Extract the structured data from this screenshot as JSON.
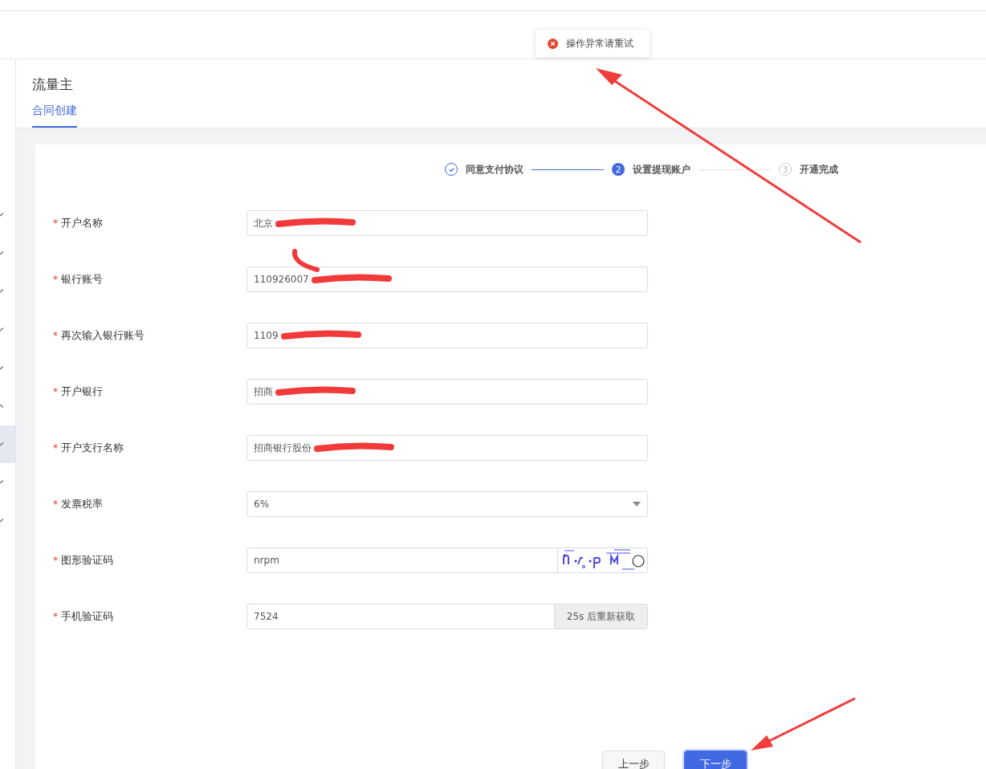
{
  "toast": {
    "kind": "error",
    "message": "操作异常请重试"
  },
  "sidebar": {
    "items": [
      {
        "expanded": false,
        "selected": false
      },
      {
        "expanded": false,
        "selected": false
      },
      {
        "expanded": false,
        "selected": false
      },
      {
        "expanded": false,
        "selected": false
      },
      {
        "expanded": false,
        "selected": false
      },
      {
        "expanded": true,
        "selected": false
      },
      {
        "expanded": false,
        "selected": true
      },
      {
        "expanded": false,
        "selected": false
      },
      {
        "expanded": false,
        "selected": false
      }
    ]
  },
  "page_header": {
    "title": "流量主",
    "tabs": [
      {
        "label": "合同创建",
        "selected": true
      }
    ]
  },
  "steps": [
    {
      "kind": "done",
      "label": "同意支付协议"
    },
    {
      "kind": "active",
      "number": "2",
      "label": "设置提现账户"
    },
    {
      "kind": "wait",
      "number": "3",
      "label": "开通完成"
    }
  ],
  "form": [
    {
      "kind": "text",
      "label": "开户名称",
      "required_mark": "*",
      "value": "北京",
      "redacted": true
    },
    {
      "kind": "text",
      "label": "银行账号",
      "required_mark": "*",
      "value": "110926007",
      "redacted": true
    },
    {
      "kind": "text",
      "label": "再次输入银行账号",
      "required_mark": "*",
      "value": "1109",
      "redacted": true
    },
    {
      "kind": "text",
      "label": "开户银行",
      "required_mark": "*",
      "value": "招商",
      "redacted": true
    },
    {
      "kind": "text",
      "label": "开户支行名称",
      "required_mark": "*",
      "value": "招商银行股份",
      "redacted": true
    },
    {
      "kind": "select",
      "label": "发票税率",
      "required_mark": "*",
      "value": "6%"
    },
    {
      "kind": "captcha",
      "label": "图形验证码",
      "required_mark": "*",
      "value": "nrpm"
    },
    {
      "kind": "sms",
      "label": "手机验证码",
      "required_mark": "*",
      "value": "7524",
      "button": "25s 后重新获取",
      "disabled": true
    }
  ],
  "buttons": [
    {
      "label": "上一步",
      "primary": false
    },
    {
      "label": "下一步",
      "primary": true
    }
  ]
}
